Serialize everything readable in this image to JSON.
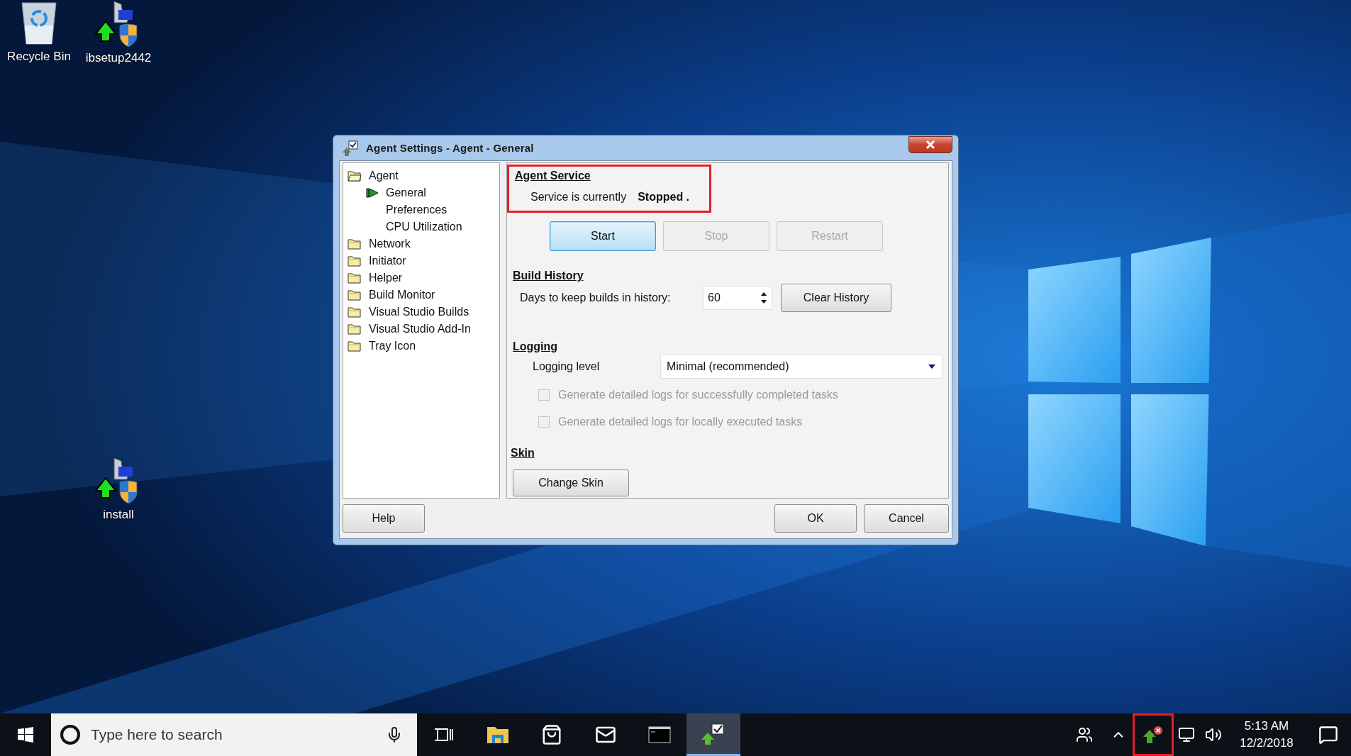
{
  "desktop_icons": [
    {
      "label": "Recycle Bin",
      "kind": "bin"
    },
    {
      "label": "ibsetup2442",
      "kind": "installer"
    },
    {
      "label": "install",
      "kind": "installer"
    }
  ],
  "dialog": {
    "title": "Agent Settings - Agent - General",
    "tree": [
      {
        "label": "Agent",
        "expanded": true,
        "selected": false,
        "children": [
          {
            "label": "General",
            "selected": true
          },
          {
            "label": "Preferences",
            "selected": false
          },
          {
            "label": "CPU Utilization",
            "selected": false
          }
        ]
      },
      {
        "label": "Network",
        "expanded": false,
        "selected": false
      },
      {
        "label": "Initiator",
        "expanded": false,
        "selected": false
      },
      {
        "label": "Helper",
        "expanded": false,
        "selected": false
      },
      {
        "label": "Build Monitor",
        "expanded": false,
        "selected": false
      },
      {
        "label": "Visual Studio Builds",
        "expanded": false,
        "selected": false
      },
      {
        "label": "Visual Studio Add-In",
        "expanded": false,
        "selected": false
      },
      {
        "label": "Tray Icon",
        "expanded": false,
        "selected": false
      }
    ],
    "agent_service": {
      "heading": "Agent Service",
      "highlighted": true,
      "status_label": "Service is currently",
      "status": "Stopped .",
      "buttons": [
        {
          "label": "Start",
          "disabled": false,
          "default": true
        },
        {
          "label": "Stop",
          "disabled": true,
          "default": false
        },
        {
          "label": "Restart",
          "disabled": true,
          "default": false
        }
      ]
    },
    "build_history": {
      "heading": "Build History",
      "days_label": "Days to keep builds in history:",
      "days_value": "60",
      "clear_button": "Clear History"
    },
    "logging": {
      "heading": "Logging",
      "level_label": "Logging level",
      "level_value": "Minimal (recommended)",
      "options": [
        {
          "label": "Generate detailed logs for successfully completed tasks",
          "checked": false,
          "disabled": true
        },
        {
          "label": "Generate detailed logs for locally executed tasks",
          "checked": false,
          "disabled": true
        }
      ]
    },
    "skin": {
      "heading": "Skin",
      "button": "Change Skin"
    },
    "help_button": "Help",
    "ok_button": "OK",
    "cancel_button": "Cancel"
  },
  "taskbar": {
    "search_placeholder": "Type here to search",
    "apps": [
      {
        "kind": "task-view",
        "active": false
      },
      {
        "kind": "explorer",
        "active": false
      },
      {
        "kind": "store",
        "active": false
      },
      {
        "kind": "mail",
        "active": false
      },
      {
        "kind": "console",
        "active": false
      },
      {
        "kind": "agent",
        "active": true
      }
    ],
    "tray_agent_highlighted": true,
    "time": "5:13 AM",
    "date": "12/2/2018"
  }
}
